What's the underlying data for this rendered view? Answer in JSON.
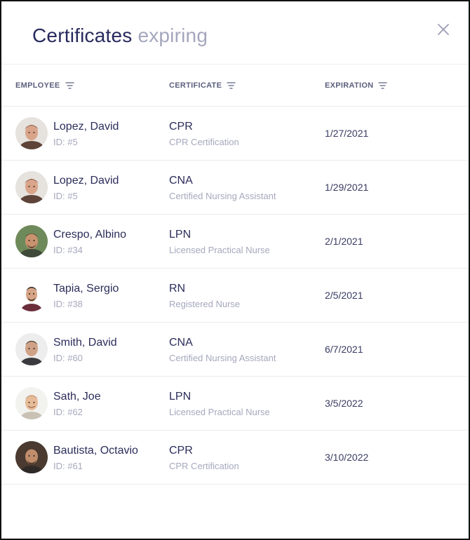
{
  "header": {
    "title_main": "Certificates",
    "title_sub": "expiring",
    "close_icon": "close-icon"
  },
  "columns": {
    "employee": "EMPLOYEE",
    "certificate": "CERTIFICATE",
    "expiration": "EXPIRATION",
    "filter_icon": "filter-icon"
  },
  "rows": [
    {
      "name": "Lopez, David",
      "id": "ID: #5",
      "cert_code": "CPR",
      "cert_name": "CPR Certification",
      "expiration": "1/27/2021",
      "avatar_icon": "avatar"
    },
    {
      "name": "Lopez, David",
      "id": "ID: #5",
      "cert_code": "CNA",
      "cert_name": "Certified Nursing Assistant",
      "expiration": "1/29/2021",
      "avatar_icon": "avatar"
    },
    {
      "name": "Crespo, Albino",
      "id": "ID: #34",
      "cert_code": "LPN",
      "cert_name": "Licensed Practical Nurse",
      "expiration": "2/1/2021",
      "avatar_icon": "avatar"
    },
    {
      "name": "Tapia, Sergio",
      "id": "ID: #38",
      "cert_code": "RN",
      "cert_name": "Registered Nurse",
      "expiration": "2/5/2021",
      "avatar_icon": "avatar"
    },
    {
      "name": "Smith, David",
      "id": "ID: #60",
      "cert_code": "CNA",
      "cert_name": "Certified Nursing Assistant",
      "expiration": "6/7/2021",
      "avatar_icon": "avatar"
    },
    {
      "name": "Sath, Joe",
      "id": "ID: #62",
      "cert_code": "LPN",
      "cert_name": "Licensed Practical Nurse",
      "expiration": "3/5/2022",
      "avatar_icon": "avatar"
    },
    {
      "name": "Bautista, Octavio",
      "id": "ID: #61",
      "cert_code": "CPR",
      "cert_name": "CPR Certification",
      "expiration": "3/10/2022",
      "avatar_icon": "avatar"
    }
  ],
  "colors": {
    "title": "#282a5e",
    "title_sub": "#a4a7bd",
    "text_primary": "#2b2d5a",
    "text_secondary": "#a6a8bd",
    "divider": "#ececf1"
  }
}
